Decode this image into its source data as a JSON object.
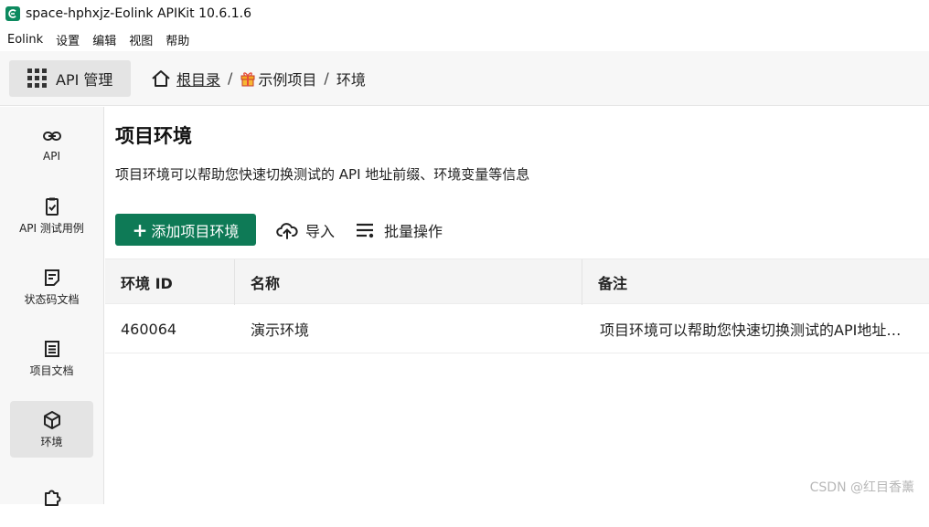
{
  "window": {
    "title": "space-hphxjz-Eolink APIKit 10.6.1.6"
  },
  "menu": [
    "Eolink",
    "设置",
    "编辑",
    "视图",
    "帮助"
  ],
  "topbar": {
    "module_label": "API 管理",
    "breadcrumb": {
      "root": "根目录",
      "sep1": "/",
      "project": "示例项目",
      "sep2": "/",
      "current": "环境"
    }
  },
  "sidebar": {
    "items": [
      {
        "label": "API",
        "icon": "link-icon"
      },
      {
        "label": "API 测试用例",
        "icon": "clipboard-check-icon"
      },
      {
        "label": "状态码文档",
        "icon": "document-icon"
      },
      {
        "label": "项目文档",
        "icon": "list-document-icon"
      },
      {
        "label": "环境",
        "icon": "cube-icon"
      },
      {
        "label": "",
        "icon": "puzzle-icon"
      }
    ],
    "active_index": 4
  },
  "main": {
    "title": "项目环境",
    "description": "项目环境可以帮助您快速切换测试的 API 地址前缀、环境变量等信息",
    "toolbar": {
      "add_label": "添加项目环境",
      "import_label": "导入",
      "batch_label": "批量操作"
    },
    "table": {
      "columns": [
        "环境 ID",
        "名称",
        "备注"
      ],
      "rows": [
        {
          "id": "460064",
          "name": "演示环境",
          "note": "项目环境可以帮助您快速切换测试的API地址…"
        }
      ]
    }
  },
  "watermark": "CSDN @红目香薰",
  "colors": {
    "primary": "#0e7a56",
    "logo": "#0d8a5f"
  }
}
